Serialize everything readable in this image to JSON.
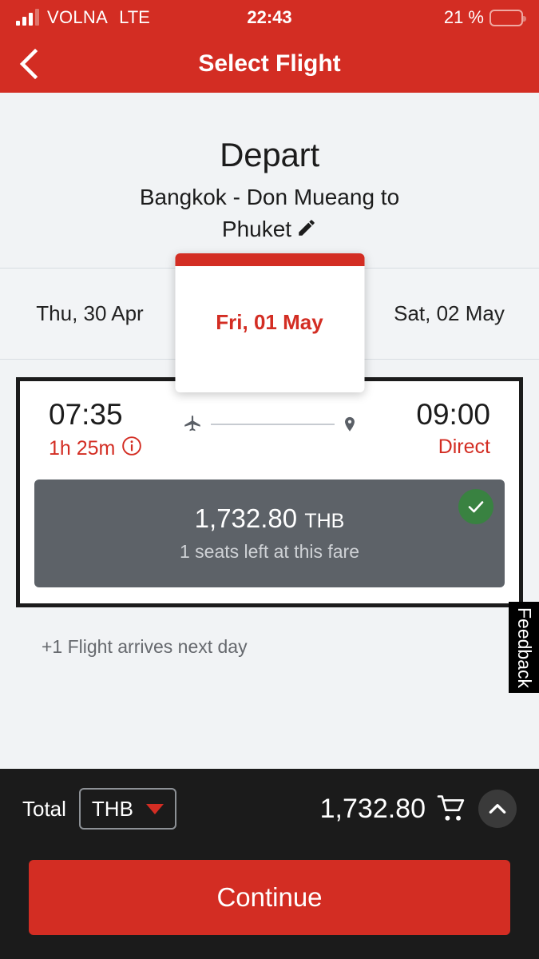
{
  "status_bar": {
    "carrier": "VOLNA",
    "network": "LTE",
    "time": "22:43",
    "battery_percent": "21 %"
  },
  "nav": {
    "title": "Select Flight",
    "back_icon": "chevron-left-icon"
  },
  "depart": {
    "title": "Depart",
    "route": "Bangkok - Don Mueang to Phuket",
    "edit_icon": "pencil-icon"
  },
  "dates": [
    {
      "label": "Thu, 30 Apr",
      "selected": false
    },
    {
      "label": "Fri, 01 May",
      "selected": true
    },
    {
      "label": "Sat, 02 May",
      "selected": false
    }
  ],
  "flight": {
    "depart_time": "07:35",
    "arrive_time": "09:00",
    "duration": "1h 25m",
    "info_icon": "info-circle-icon",
    "stops": "Direct",
    "plane_icon": "airplane-icon",
    "destination_icon": "map-pin-icon",
    "fare": {
      "amount": "1,732.80",
      "currency": "THB",
      "seats_note": "1 seats left at this fare",
      "selected_icon": "check-circle-icon"
    }
  },
  "note": "+1 Flight arrives next day",
  "feedback": {
    "label": "Feedback"
  },
  "bottom": {
    "total_label": "Total",
    "currency": "THB",
    "currency_caret_icon": "caret-down-icon",
    "total_amount": "1,732.80",
    "cart_icon": "shopping-cart-icon",
    "expand_icon": "chevron-up-icon",
    "continue_label": "Continue"
  },
  "colors": {
    "brand_red": "#d32d23",
    "dark_bar": "#1b1b1b",
    "fare_gray": "#5d6268",
    "check_green": "#398241",
    "battery_yellow": "#f7d04a"
  }
}
